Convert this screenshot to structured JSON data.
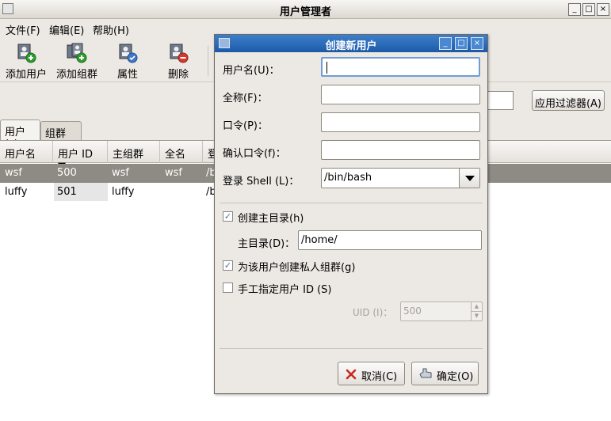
{
  "main": {
    "title": "用户管理者",
    "window_buttons": {
      "minimize": "_",
      "maximize": "□",
      "close": "×"
    },
    "menu": [
      "文件(F)",
      "编辑(E)",
      "帮助(H)"
    ],
    "toolbar": {
      "add_user": "添加用户",
      "add_group": "添加组群",
      "properties": "属性",
      "delete": "删除"
    },
    "apply_filter": "应用过滤器(A)",
    "tabs": [
      "用户(s)",
      "组群(o)"
    ],
    "columns": [
      "用户名",
      "用户 ID ▼",
      "主组群",
      "全名",
      "登"
    ],
    "rows": [
      {
        "username": "wsf",
        "uid": "500",
        "group": "wsf",
        "fullname": "wsf",
        "home": "/b",
        "selected": true
      },
      {
        "username": "luffy",
        "uid": "501",
        "group": "luffy",
        "fullname": "",
        "home": "/b",
        "selected": false
      }
    ]
  },
  "dialog": {
    "title": "创建新用户",
    "window_buttons": {
      "minimize": "_",
      "maximize": "□",
      "close": "×"
    },
    "fields": {
      "username_label": "用户名(U)：",
      "fullname_label": "全称(F)：",
      "password_label": "口令(P)：",
      "confirm_label": "确认口令(f)：",
      "shell_label": "登录 Shell (L)：",
      "shell_value": "/bin/bash"
    },
    "create_home": {
      "label": "创建主目录(h)",
      "checked": true
    },
    "home_dir": {
      "label": "主目录(D)：",
      "value": "/home/"
    },
    "private_group": {
      "label": "为该用户创建私人组群(g)",
      "checked": true
    },
    "manual_uid": {
      "label": "手工指定用户 ID (S)",
      "checked": false
    },
    "uid": {
      "label": "UID (I)：",
      "value": "500"
    },
    "cancel_label": "取消(C)",
    "ok_label": "确定(O)"
  },
  "colors": {
    "selection": "#8e8a84",
    "dialog_title": "#2a6bbd",
    "window_bg": "#ece9e4"
  }
}
